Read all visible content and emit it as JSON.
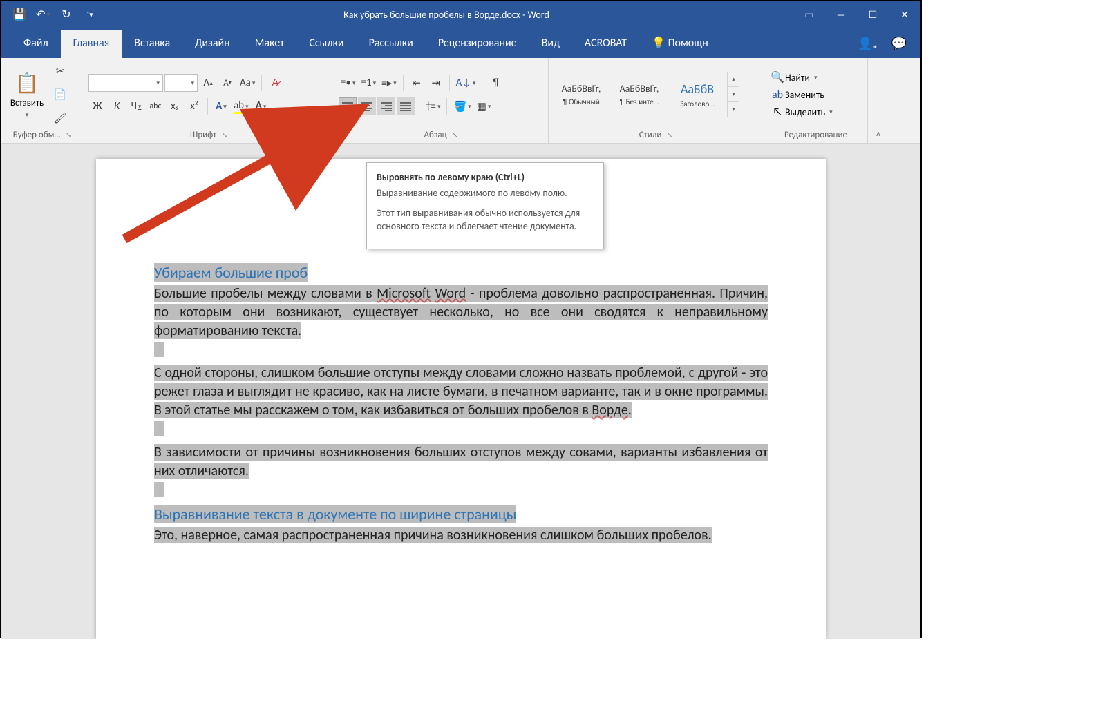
{
  "titlebar": {
    "title": "Как убрать большие пробелы в Ворде.docx - Word"
  },
  "tabs": {
    "file": "Файл",
    "home": "Главная",
    "insert": "Вставка",
    "design": "Дизайн",
    "layout": "Макет",
    "references": "Ссылки",
    "mailings": "Рассылки",
    "review": "Рецензирование",
    "view": "Вид",
    "acrobat": "ACROBAT",
    "tell_me": "Помощн"
  },
  "ribbon": {
    "clipboard": {
      "label": "Буфер обм…",
      "paste": "Вставить"
    },
    "font": {
      "label": "Шрифт",
      "bold": "Ж",
      "italic": "К",
      "underline": "Ч",
      "strike": "abc",
      "sub": "x₂",
      "sup": "x²",
      "grow": "A",
      "shrink": "A",
      "case": "Aa",
      "clear": "⌫"
    },
    "paragraph": {
      "label": "Абзац"
    },
    "styles": {
      "label": "Стили",
      "items": [
        {
          "sample": "АаБбВвГг,",
          "name": "¶ Обычный"
        },
        {
          "sample": "АаБбВвГг,",
          "name": "¶ Без инте…"
        },
        {
          "sample": "АаБбВ",
          "name": "Заголово…"
        }
      ]
    },
    "editing": {
      "label": "Редактирование",
      "find": "Найти",
      "replace": "Заменить",
      "select": "Выделить"
    }
  },
  "tooltip": {
    "title": "Выровнять по левому краю (Ctrl+L)",
    "body1": "Выравнивание содержимого по левому полю.",
    "body2": "Этот тип выравнивания обычно используется для основного текста и облегчает чтение документа."
  },
  "document": {
    "h1": "Убираем большие проб",
    "p1a": "Большие пробелы между словами в ",
    "p1_ms": "Microsoft",
    "p1_sp": " ",
    "p1_word": "Word",
    "p1b": " - проблема довольно распространенная. Причин, по которым они возникают, существует несколько, но все они сводятся к неправильному форматированию текста.",
    "p2a": "С одной стороны, слишком большие отступы между словами сложно назвать проблемой, с другой - это режет глаза и выглядит не красиво, как на листе бумаги, в печатном варианте, так и в окне программы. В этой статье мы расскажем о том, как избавиться от больших пробелов в ",
    "p2_word": "Ворде",
    "p2b": ".",
    "p3": "В зависимости от причины возникновения больших отступов между совами, варианты избавления от них отличаются.",
    "h2": "Выравнивание текста в документе по ширине страницы",
    "p4": "Это, наверное, самая распространенная причина возникновения слишком больших пробелов."
  }
}
